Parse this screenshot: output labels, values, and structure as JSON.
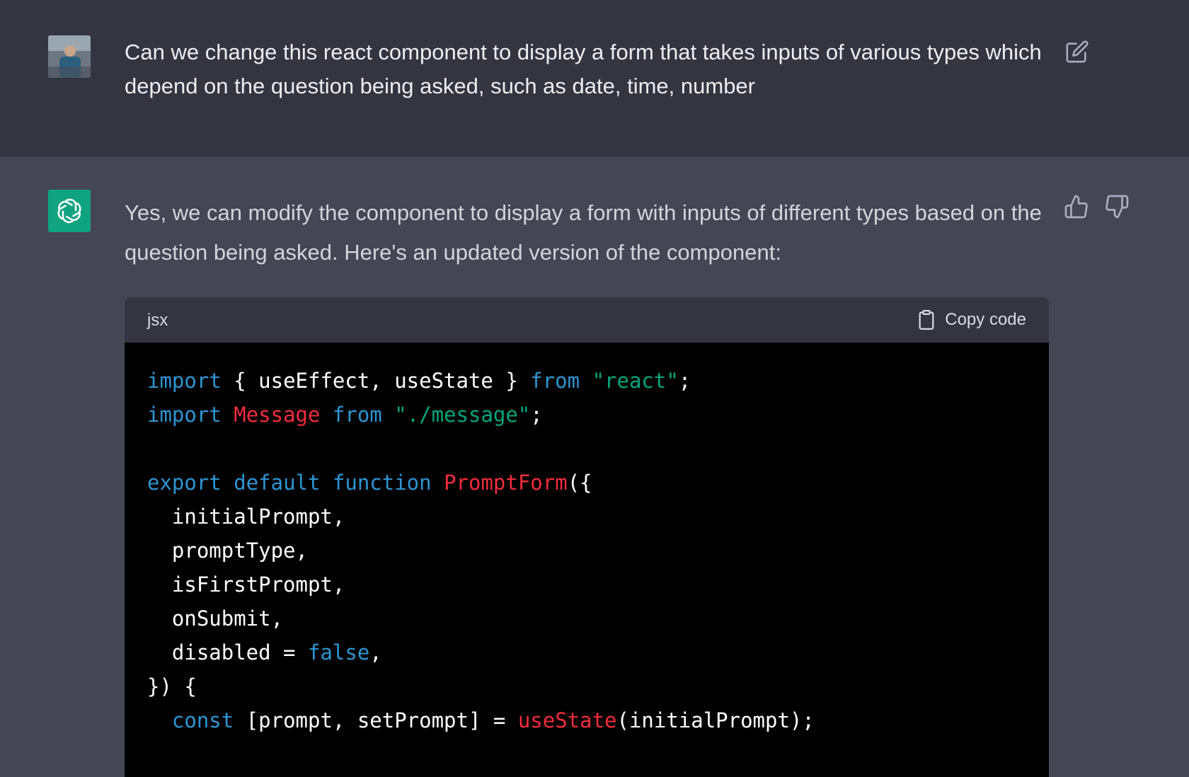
{
  "user_message": {
    "text": "Can we change this react component to display a form that takes inputs of various types which depend on the question being asked, such as date, time, number"
  },
  "assistant_message": {
    "text": "Yes, we can modify the component to display a form with inputs of different types based on the question being asked. Here's an updated version of the component:"
  },
  "code_block": {
    "language": "jsx",
    "copy_label": "Copy code",
    "lines": [
      [
        {
          "t": "import",
          "c": "kw"
        },
        {
          "t": " { useEffect, useState } ",
          "c": ""
        },
        {
          "t": "from",
          "c": "kw"
        },
        {
          "t": " ",
          "c": ""
        },
        {
          "t": "\"react\"",
          "c": "str"
        },
        {
          "t": ";",
          "c": ""
        }
      ],
      [
        {
          "t": "import",
          "c": "kw"
        },
        {
          "t": " ",
          "c": ""
        },
        {
          "t": "Message",
          "c": "fn"
        },
        {
          "t": " ",
          "c": ""
        },
        {
          "t": "from",
          "c": "kw"
        },
        {
          "t": " ",
          "c": ""
        },
        {
          "t": "\"./message\"",
          "c": "str"
        },
        {
          "t": ";",
          "c": ""
        }
      ],
      [],
      [
        {
          "t": "export",
          "c": "kw"
        },
        {
          "t": " ",
          "c": ""
        },
        {
          "t": "default",
          "c": "kw"
        },
        {
          "t": " ",
          "c": ""
        },
        {
          "t": "function",
          "c": "kw"
        },
        {
          "t": " ",
          "c": ""
        },
        {
          "t": "PromptForm",
          "c": "fn"
        },
        {
          "t": "({",
          "c": ""
        }
      ],
      [
        {
          "t": "  initialPrompt,",
          "c": ""
        }
      ],
      [
        {
          "t": "  promptType,",
          "c": ""
        }
      ],
      [
        {
          "t": "  isFirstPrompt,",
          "c": ""
        }
      ],
      [
        {
          "t": "  onSubmit,",
          "c": ""
        }
      ],
      [
        {
          "t": "  disabled = ",
          "c": ""
        },
        {
          "t": "false",
          "c": "kw"
        },
        {
          "t": ",",
          "c": ""
        }
      ],
      [
        {
          "t": "}) {",
          "c": ""
        }
      ],
      [
        {
          "t": "  ",
          "c": ""
        },
        {
          "t": "const",
          "c": "kw"
        },
        {
          "t": " [prompt, setPrompt] = ",
          "c": ""
        },
        {
          "t": "useState",
          "c": "fn"
        },
        {
          "t": "(initialPrompt);",
          "c": ""
        }
      ]
    ]
  },
  "colors": {
    "user_bg": "#343541",
    "assistant_bg": "#444654",
    "brand_green": "#10a37f",
    "keyword": "#2e95d3",
    "string": "#00a67d",
    "function": "#f22c3d"
  },
  "icons": {
    "edit": "edit-icon",
    "thumb_up": "thumbs-up-icon",
    "thumb_down": "thumbs-down-icon",
    "copy": "clipboard-icon",
    "assistant_logo": "openai-logo-icon"
  }
}
